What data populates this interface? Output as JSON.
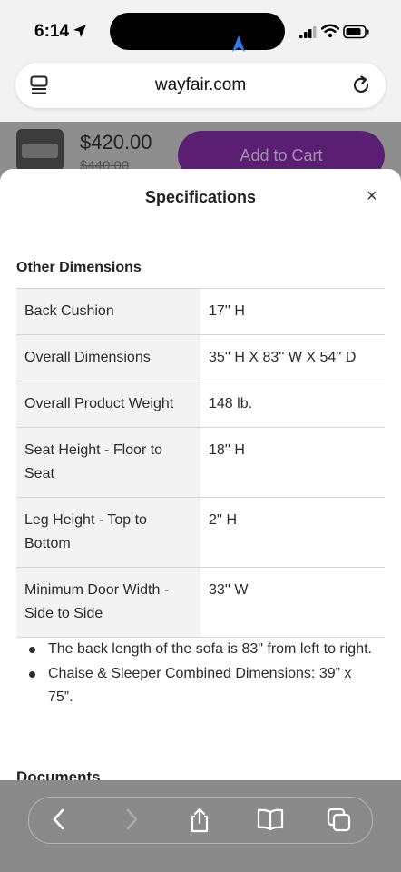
{
  "status_bar": {
    "time": "6:14"
  },
  "browser": {
    "url": "wayfair.com"
  },
  "product_bar": {
    "price": "$420.00",
    "old_price": "$440.00",
    "add_to_cart_label": "Add to Cart"
  },
  "sheet": {
    "title": "Specifications",
    "close_label": "×",
    "section_title": "Other Dimensions",
    "rows": [
      {
        "label": "Back Cushion",
        "value": "17'' H"
      },
      {
        "label": "Overall Dimensions",
        "value": "35'' H X 83'' W X 54'' D"
      },
      {
        "label": "Overall Product Weight",
        "value": "148 lb."
      },
      {
        "label": "Seat Height - Floor to Seat",
        "value": "18'' H"
      },
      {
        "label": "Leg Height - Top to Bottom",
        "value": "2'' H"
      },
      {
        "label": "Minimum Door Width - Side to Side",
        "value": "33'' W"
      }
    ],
    "bullets": [
      "The back length of the sofa is 83\" from left to right.",
      "Chaise & Sleeper Combined Dimensions: 39” x 75”."
    ],
    "next_section": "Documents"
  },
  "colors": {
    "accent_purple": "#5a1f72",
    "dimmed_background": "#8c8c8c"
  }
}
